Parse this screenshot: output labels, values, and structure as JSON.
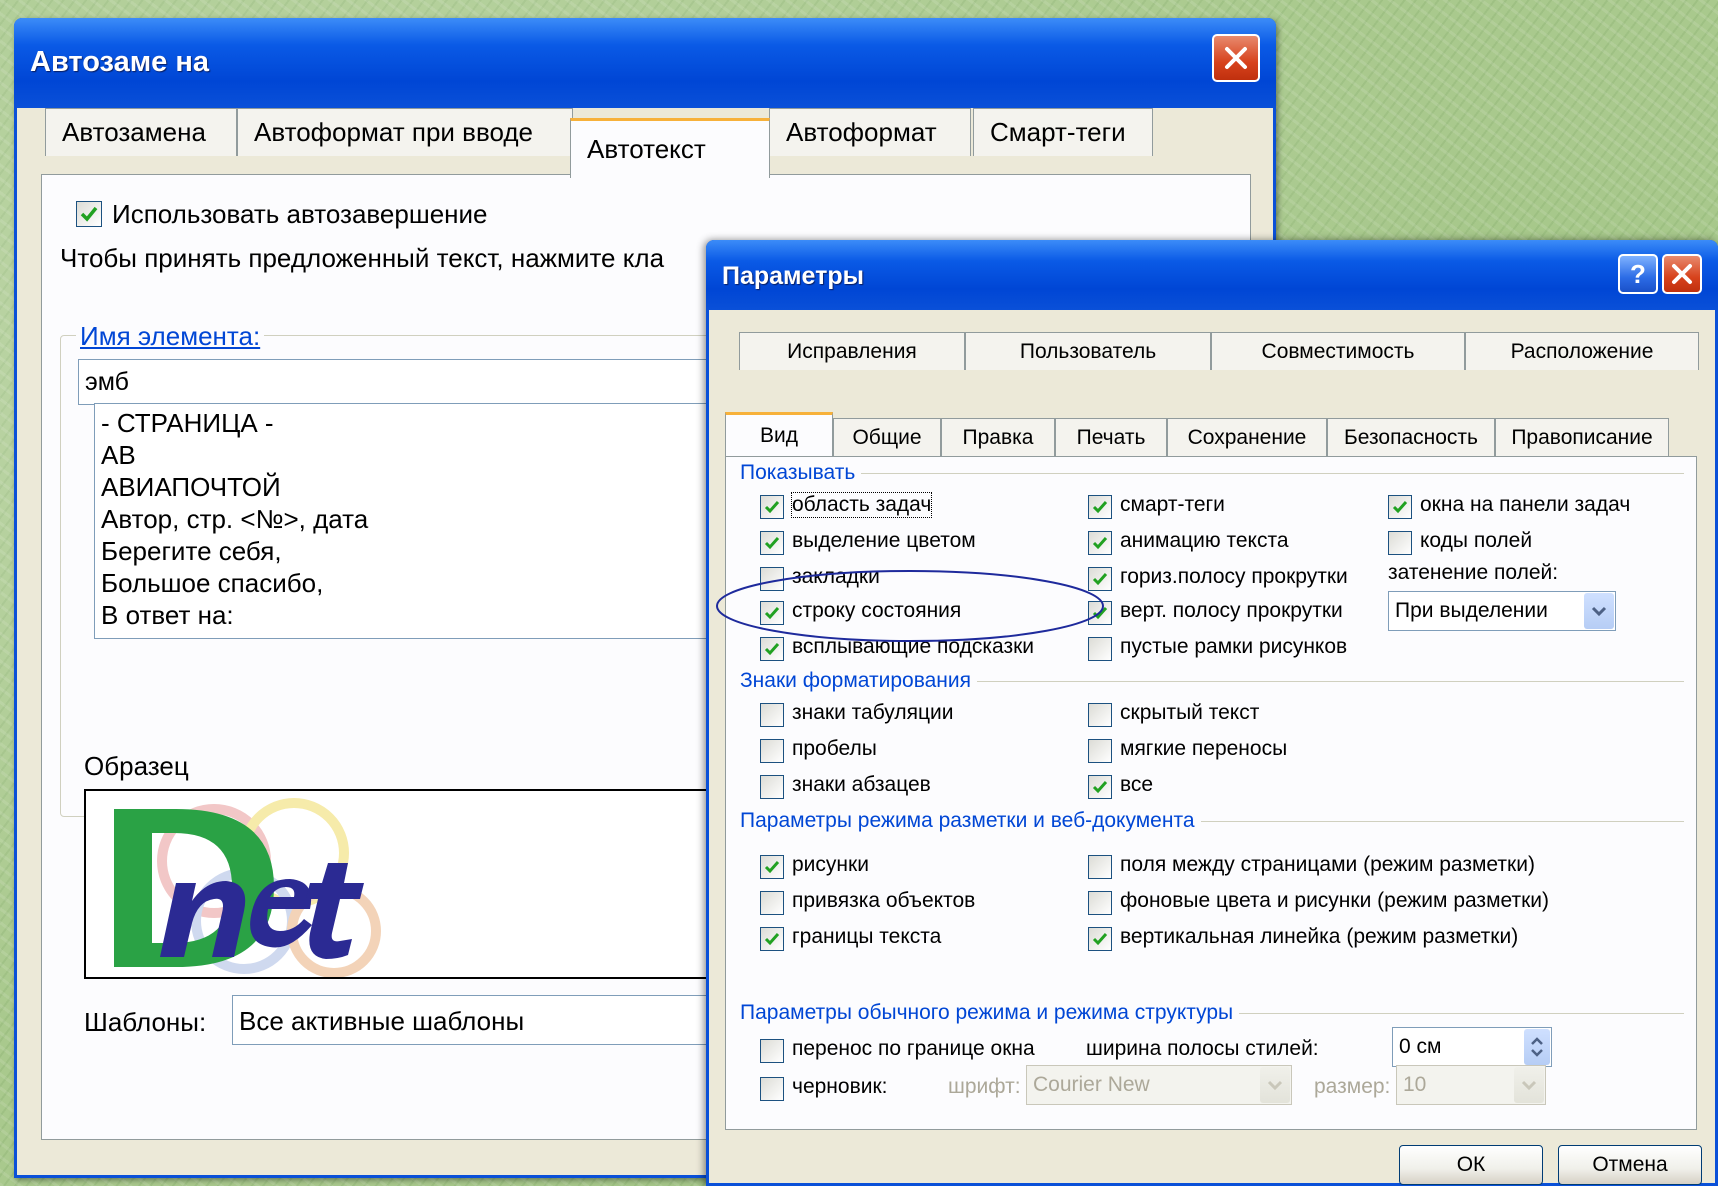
{
  "autocorrect": {
    "title": "Автозаме на",
    "tabs": [
      "Автозамена",
      "Автоформат при вводе",
      "Автотекст",
      "Автоформат",
      "Смарт-теги"
    ],
    "active_tab": "Автотекст",
    "use_autocomplete_label": "Использовать автозавершение",
    "hint": "Чтобы принять предложенный текст, нажмите кла",
    "element_name_label": "Имя элемента:",
    "element_name_value": "эмб",
    "entries": [
      "- СТРАНИЦА -",
      "АВ",
      "АВИАПОЧТОЙ",
      "Автор, стр. <№>, дата",
      "Берегите себя,",
      "Большое спасибо,",
      "В ответ на:"
    ],
    "sample_label": "Образец",
    "templates_label": "Шаблоны:",
    "templates_value": "Все активные шаблоны"
  },
  "options": {
    "title": "Параметры",
    "help": "?",
    "tabs_row1": [
      "Исправления",
      "Пользователь",
      "Совместимость",
      "Расположение"
    ],
    "tabs_row2": [
      "Вид",
      "Общие",
      "Правка",
      "Печать",
      "Сохранение",
      "Безопасность",
      "Правописание"
    ],
    "active_tab": "Вид",
    "show_group": "Показывать",
    "show": {
      "task_pane": "область задач",
      "highlight": "выделение цветом",
      "bookmarks": "закладки",
      "status_bar": "строку состояния",
      "screen_tips": "всплывающие подсказки",
      "smart_tags": "смарт-теги",
      "animated_text": "анимацию текста",
      "h_scroll": "гориз.полосу прокрутки",
      "v_scroll": "верт. полосу прокрутки",
      "picture_placeholders": "пустые рамки рисунков",
      "windows_taskbar": "окна на панели задач",
      "field_codes": "коды полей",
      "field_shading_label": "затенение полей:",
      "field_shading_value": "При выделении"
    },
    "formatting_group": "Знаки форматирования",
    "formatting": {
      "tabs": "знаки табуляции",
      "spaces": "пробелы",
      "paragraphs": "знаки абзацев",
      "hidden": "скрытый текст",
      "hyphens": "мягкие переносы",
      "all": "все"
    },
    "layout_group": "Параметры режима разметки и веб-документа",
    "layout": {
      "drawings": "рисунки",
      "anchors": "привязка объектов",
      "boundaries": "границы текста",
      "whitespace": "поля между страницами (режим разметки)",
      "background": "фоновые цвета и рисунки (режим разметки)",
      "vruler": "вертикальная линейка (режим разметки)"
    },
    "normal_group": "Параметры обычного режима и режима структуры",
    "normal": {
      "wrap": "перенос по границе окна",
      "style_width_label": "ширина полосы стилей:",
      "style_width_value": "0 см",
      "draft": "черновик:",
      "font_label": "шрифт:",
      "font_value": "Courier New",
      "size_label": "размер:",
      "size_value": "10"
    },
    "ok": "ОК",
    "cancel": "Отмена"
  },
  "colors": {
    "title_blue": "#0a50d8",
    "group_blue": "#0046d5",
    "tab_accent": "#f7b13a",
    "annotation": "#1e2a9c"
  }
}
